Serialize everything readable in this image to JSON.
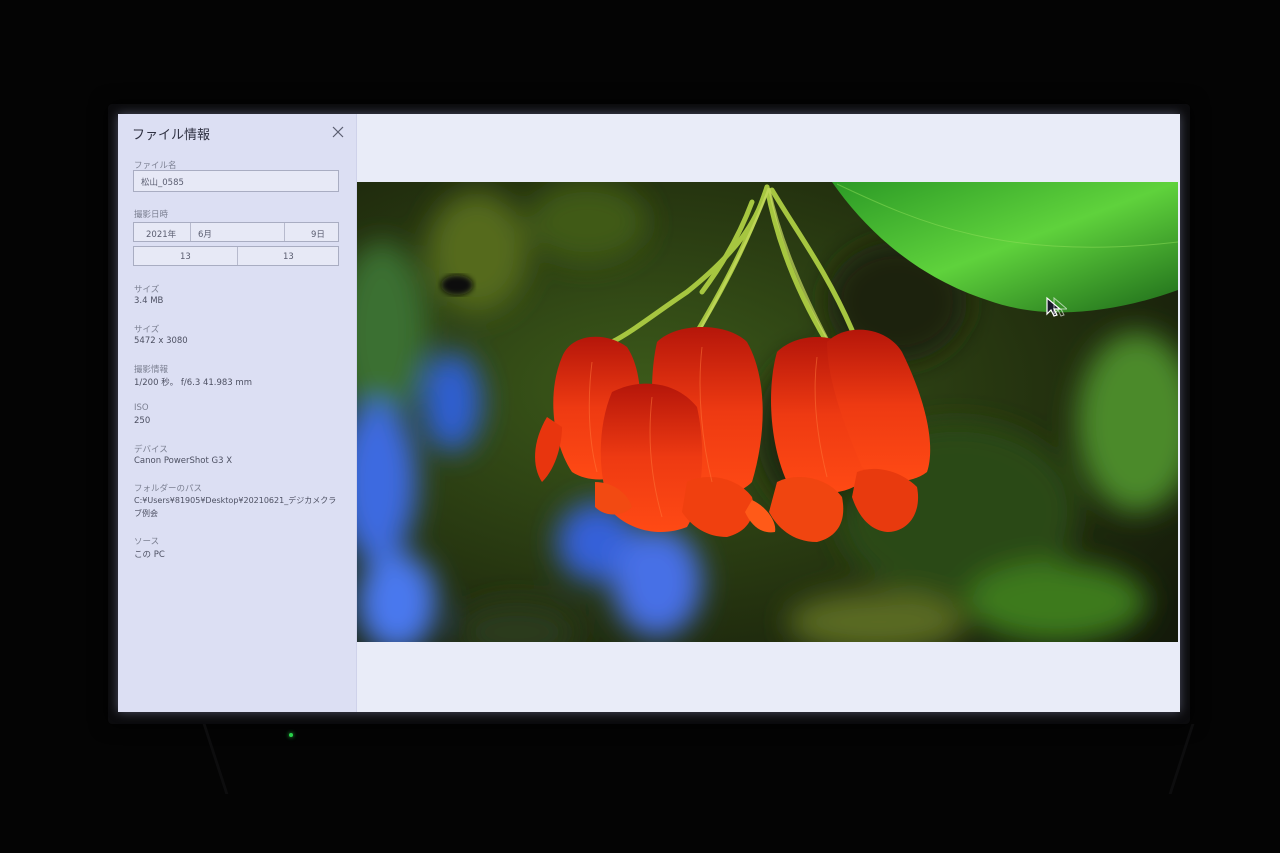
{
  "panel": {
    "title": "ファイル情報",
    "close_icon": "close-icon",
    "file_name": {
      "label": "ファイル名",
      "value": "松山_0585"
    },
    "date_taken": {
      "label": "撮影日時",
      "year": "2021年",
      "month": "6月",
      "day": "9日",
      "hour": "13",
      "minute": "13"
    },
    "size": {
      "label": "サイズ",
      "value": "3.4 MB"
    },
    "dimensions": {
      "label": "サイズ",
      "value": "5472 x 3080"
    },
    "shooting_info": {
      "label": "撮影情報",
      "value": "1/200 秒。 f/6.3 41.983 mm"
    },
    "iso": {
      "label": "ISO",
      "value": "250"
    },
    "device": {
      "label": "デバイス",
      "value": "Canon PowerShot G3 X"
    },
    "folder_path": {
      "label": "フォルダーのパス",
      "line1": "C:¥Users¥81905¥Desktop¥20210621_デジカメクラ",
      "line2": "ブ例会"
    },
    "source": {
      "label": "ソース",
      "value": "この PC"
    }
  },
  "viewer": {
    "photo_subject": "red-hanging-flowers-photo",
    "cursor_icon": "mouse-pointer-icon"
  },
  "colors": {
    "panel_bg": "#dcdff3",
    "viewer_bg": "#e9ecf8",
    "flower_red": "#e02a0e",
    "leaf_green": "#3fae2e"
  }
}
